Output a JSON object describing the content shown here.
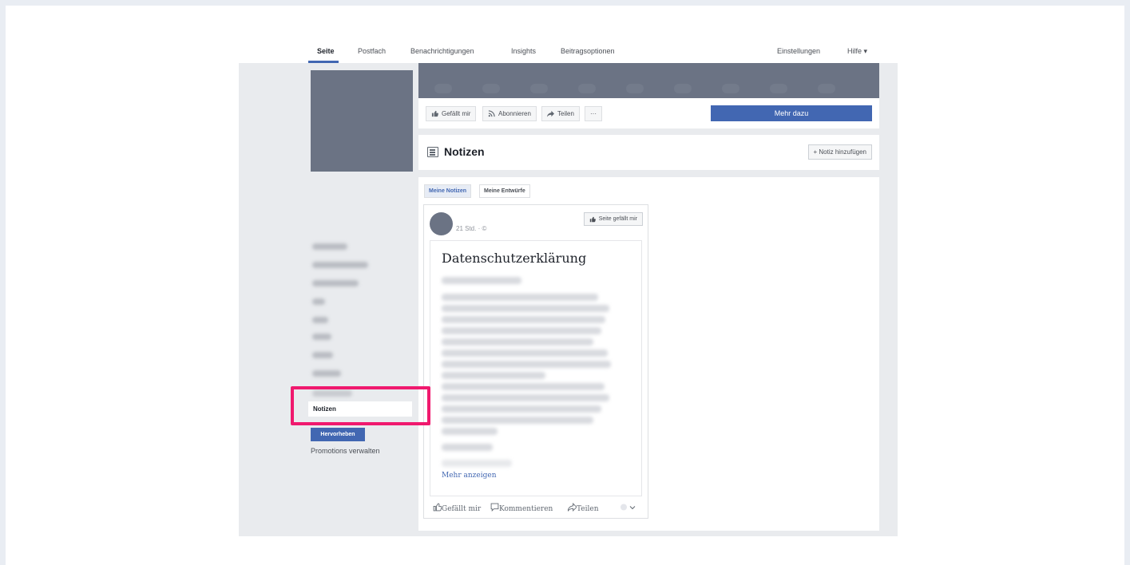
{
  "nav": {
    "tabs": [
      {
        "label": "Seite"
      },
      {
        "label": "Postfach"
      },
      {
        "label": "Benachrichtigungen"
      },
      {
        "label": "Insights"
      },
      {
        "label": "Beitragsoptionen"
      }
    ],
    "settings_label": "Einstellungen",
    "help_label": "Hilfe ▾"
  },
  "action_bar": {
    "like_label": "Gefällt mir",
    "follow_label": "Abonnieren",
    "share_label": "Teilen",
    "more_label": "···",
    "learn_more_label": "Mehr dazu"
  },
  "notes_header": {
    "title": "Notizen",
    "add_note_label": "+ Notiz hinzufügen"
  },
  "subtabs": {
    "my_notes": "Meine Notizen",
    "my_drafts": "Meine Entwürfe"
  },
  "note": {
    "meta": "21 Std. · ©",
    "like_page_label": "Seite gefällt mir",
    "title": "Datenschutzerklärung",
    "more_link": "Mehr anzeigen",
    "reactions": {
      "like": "Gefällt mir",
      "comment": "Kommentieren",
      "share": "Teilen"
    }
  },
  "left_menu": {
    "active_item": "Notizen",
    "promote_label": "Hervorheben",
    "manage_promotions_label": "Promotions verwalten"
  },
  "colors": {
    "accent": "#4267b2",
    "highlight": "#f0196e",
    "placeholder": "#6b7384"
  }
}
